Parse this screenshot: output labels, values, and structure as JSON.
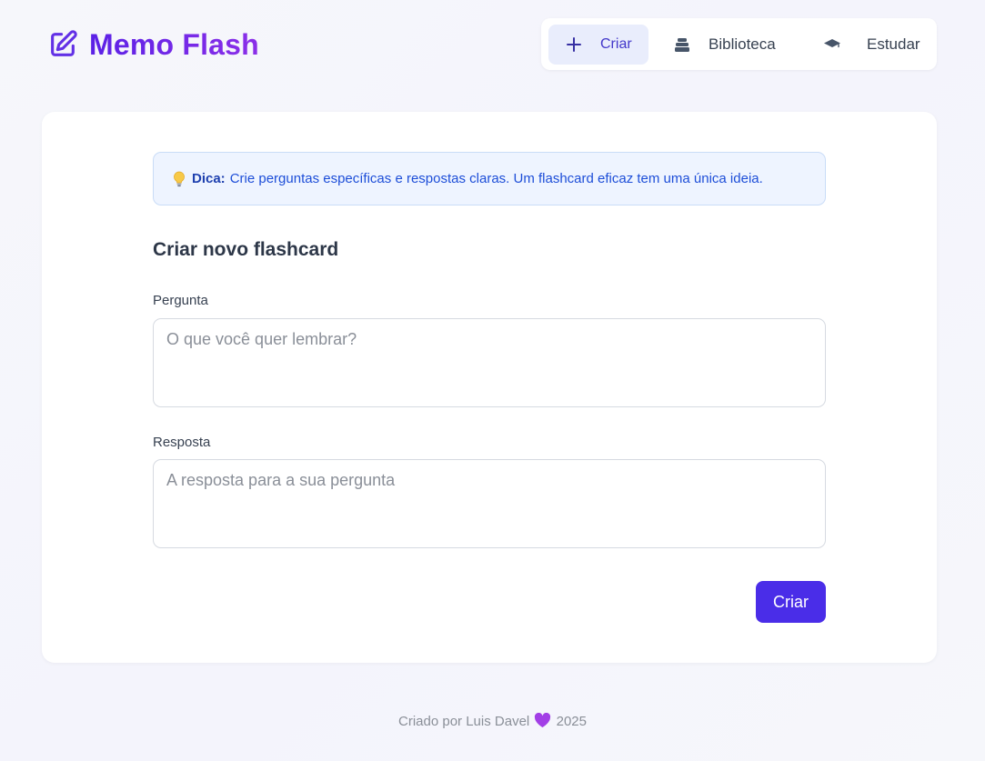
{
  "brand": {
    "name": "Memo Flash",
    "icon": "edit-icon",
    "gradient": [
      "#5b21e6",
      "#8b2fe8"
    ]
  },
  "nav": {
    "active": "Criar",
    "items": [
      {
        "label": "Criar",
        "icon": "plus-icon"
      },
      {
        "label": "Biblioteca",
        "icon": "stack-icon"
      },
      {
        "label": "Estudar",
        "icon": "graduation-cap-icon"
      }
    ]
  },
  "tip": {
    "icon": "lightbulb-icon",
    "strong": "Dica:",
    "text": "Crie perguntas específicas e respostas claras. Um flashcard eficaz tem uma única ideia."
  },
  "form": {
    "title": "Criar novo flashcard",
    "question_label": "Pergunta",
    "question_placeholder": "O que você quer lembrar?",
    "question_value": "",
    "answer_label": "Resposta",
    "answer_placeholder": "A resposta para a sua pergunta",
    "answer_value": "",
    "submit_label": "Criar"
  },
  "footer": {
    "prefix": "Criado por Luis Davel",
    "heart": "purple-heart-icon",
    "year": "2025"
  },
  "colors": {
    "accent": "#4a2de8",
    "tip_background": "#eef4ff",
    "tip_text": "#1d4ed8",
    "active_nav_background": "#e9edfc"
  }
}
